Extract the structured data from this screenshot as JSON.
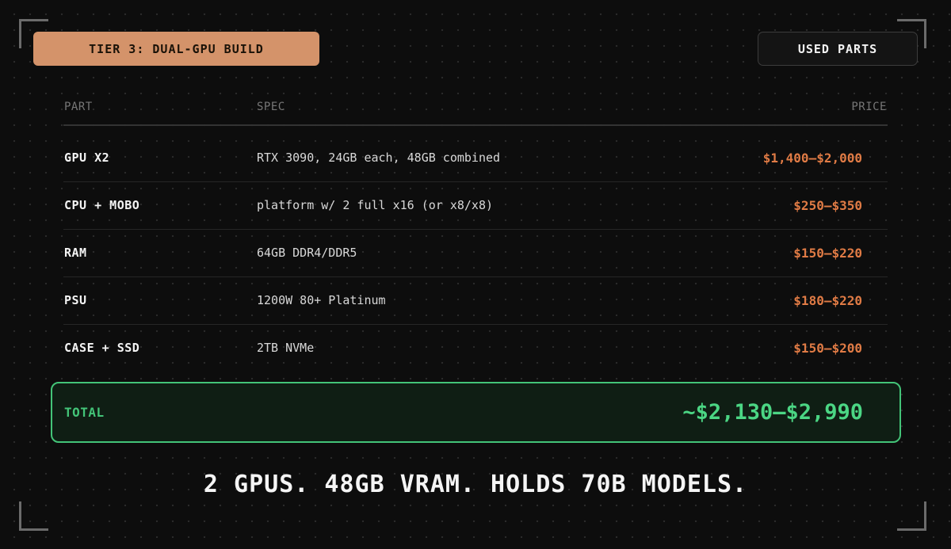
{
  "header": {
    "tier_label": "TIER 3: DUAL-GPU BUILD",
    "condition_label": "USED PARTS"
  },
  "table": {
    "columns": {
      "part": "PART",
      "spec": "SPEC",
      "price": "PRICE"
    },
    "rows": [
      {
        "part": "GPU X2",
        "spec": "RTX 3090, 24GB each, 48GB combined",
        "price": "$1,400–$2,000"
      },
      {
        "part": "CPU + MOBO",
        "spec": "platform w/ 2 full x16 (or x8/x8)",
        "price": "$250–$350"
      },
      {
        "part": "RAM",
        "spec": "64GB DDR4/DDR5",
        "price": "$150–$220"
      },
      {
        "part": "PSU",
        "spec": "1200W 80+ Platinum",
        "price": "$180–$220"
      },
      {
        "part": "CASE + SSD",
        "spec": "2TB NVMe",
        "price": "$150–$200"
      }
    ]
  },
  "total": {
    "label": "TOTAL",
    "value": "~$2,130–$2,990"
  },
  "tagline": "2 GPUS. 48GB VRAM. HOLDS 70B MODELS.",
  "colors": {
    "background": "#0d0d0d",
    "tier_badge": "#d4936a",
    "price": "#e07b45",
    "total_accent": "#43c478"
  }
}
